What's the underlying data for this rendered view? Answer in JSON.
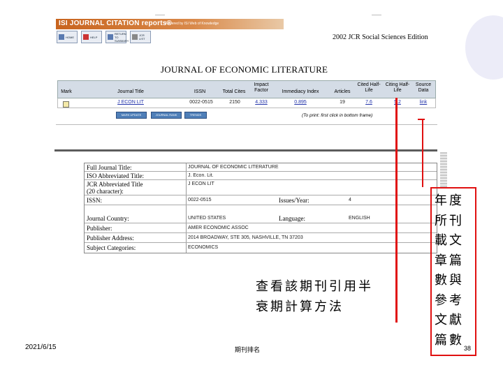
{
  "header": {
    "banner_title": "ISI JOURNAL CITATION reports®",
    "powered_by": "Powered by ISI Web of Knowledge",
    "edition": "2002 JCR Social Sciences Edition",
    "nav_buttons": [
      "HOME",
      "HELP",
      "RETURN TO SUMMARY",
      "JCR LIST"
    ]
  },
  "journal_title": "JOURNAL OF ECONOMIC LITERATURE",
  "summary_table": {
    "headers": [
      "Mark",
      "Journal Title",
      "ISSN",
      "Total Cites",
      "Impact Factor",
      "Immediacy Index",
      "Articles",
      "Cited Half-Life",
      "Citing Half-Life",
      "Source Data"
    ],
    "row": [
      "",
      "J ECON LIT",
      "0022-0515",
      "2150",
      "4.333",
      "0.895",
      "19",
      "7.6",
      "5.2",
      "link"
    ],
    "buttons": [
      "MARK UPDATE",
      "JOURNAL RANK",
      "TRENDS"
    ],
    "print_note": "(To print: first click in bottom frame)"
  },
  "details": {
    "full_title_label": "Full Journal Title:",
    "full_title": "JOURNAL OF ECONOMIC LITERATURE",
    "iso_label": "ISO Abbreviated Title:",
    "iso": "J. Econ. Lit.",
    "jcr_label_1": "JCR Abbreviated Title",
    "jcr_label_2": "(20 character):",
    "jcr": "J ECON LIT",
    "issn_label": "ISSN:",
    "issn": "0022-0515",
    "issues_label": "Issues/Year:",
    "issues": "4",
    "country_label": "Journal Country:",
    "country": "UNITED STATES",
    "language_label": "Language:",
    "language": "ENGLISH",
    "publisher_label": "Publisher:",
    "publisher": "AMER ECONOMIC ASSOC",
    "address_label": "Publisher Address:",
    "address": "2014 BROADWAY, STE 305, NASHVILLE, TN 37203",
    "subject_label": "Subject Categories:",
    "subject": "ECONOMICS"
  },
  "annotations": {
    "callout_left_line1": "查看該期刊引用半",
    "callout_left_line2": "衰期計算方法",
    "callout_right": "年度所刊載文章篇數與參考文獻篇數"
  },
  "footer": {
    "date": "2021/6/15",
    "title": "期刊排名",
    "page": "38"
  },
  "colors": {
    "annotation_red": "#e01010",
    "banner_orange": "#c8641e",
    "header_gray": "#d4dce6"
  }
}
